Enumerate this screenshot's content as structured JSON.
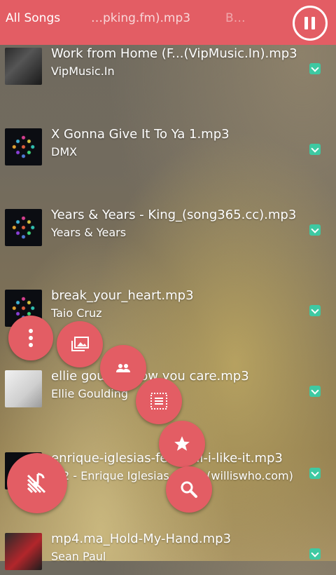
{
  "header": {
    "tabs": [
      {
        "label": "All Songs"
      },
      {
        "label": "…pking.fm).mp3"
      },
      {
        "label": "B…"
      }
    ]
  },
  "songs": [
    {
      "title": "Work from Home (F...(VipMusic.In).mp3",
      "artist": "VipMusic.In"
    },
    {
      "title": "X Gonna Give It To Ya 1.mp3",
      "artist": "DMX"
    },
    {
      "title": "Years & Years - King_(song365.cc).mp3",
      "artist": "Years & Years"
    },
    {
      "title": "break_your_heart.mp3",
      "artist": "Taio Cruz"
    },
    {
      "title": "ellie goul… know you care.mp3",
      "artist": "Ellie Goulding"
    },
    {
      "title": "enrique-iglesias-fe…bull-i-like-it.mp3",
      "artist": "…2 - Enrique Iglesias f…llis (williswho.com)"
    },
    {
      "title": "mp4.ma_Hold-My-Hand.mp3",
      "artist": "Sean Paul"
    }
  ],
  "accent_color": "#e35d64",
  "download_color": "#3ec9a2",
  "icons": {
    "pause": "pause-icon",
    "more": "more-vertical-icon",
    "gallery": "gallery-icon",
    "artists": "people-icon",
    "playlist": "playlist-icon",
    "favorites": "star-icon",
    "search": "search-icon",
    "menu_main": "music-menu-icon"
  }
}
